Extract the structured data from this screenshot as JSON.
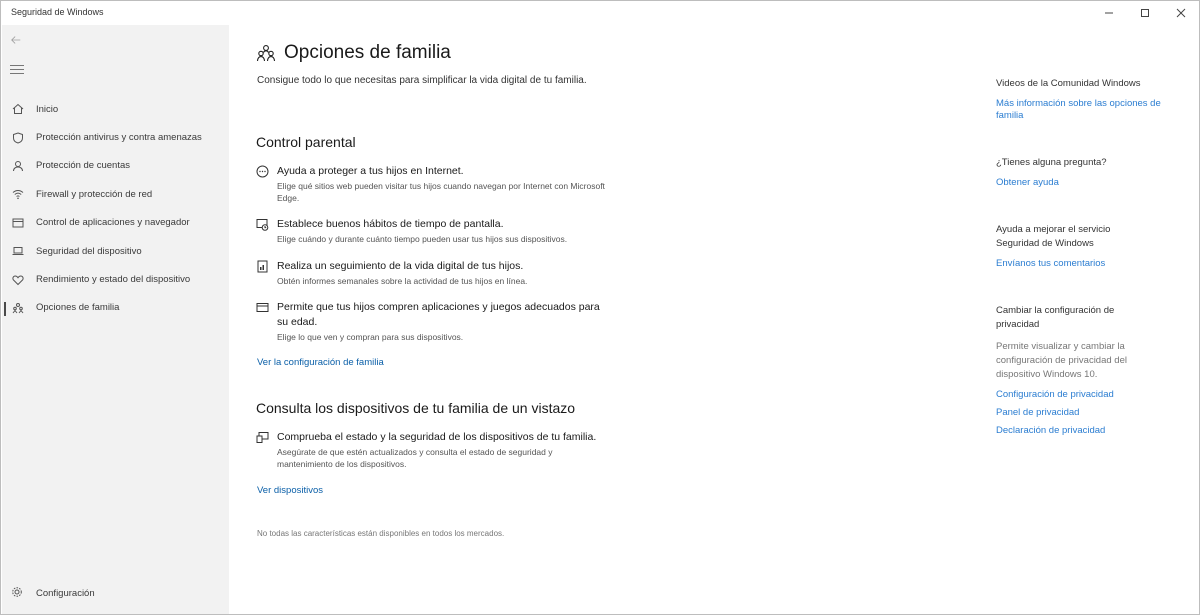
{
  "window": {
    "title": "Seguridad de Windows",
    "controls": {
      "minimize_icon": "minimize-icon",
      "maximize_icon": "maximize-icon",
      "close_icon": "close-icon"
    }
  },
  "sidebar": {
    "items": [
      {
        "label": "Inicio",
        "icon": "home-icon"
      },
      {
        "label": "Protección antivirus y contra amenazas",
        "icon": "shield-icon"
      },
      {
        "label": "Protección de cuentas",
        "icon": "person-icon"
      },
      {
        "label": "Firewall y protección de red",
        "icon": "wifi-icon"
      },
      {
        "label": "Control de aplicaciones y navegador",
        "icon": "app-browser-icon"
      },
      {
        "label": "Seguridad del dispositivo",
        "icon": "laptop-icon"
      },
      {
        "label": "Rendimiento y estado del dispositivo",
        "icon": "heart-icon"
      },
      {
        "label": "Opciones de familia",
        "icon": "family-icon",
        "active": true
      }
    ],
    "settings_label": "Configuración"
  },
  "main": {
    "title": "Opciones de familia",
    "description": "Consigue todo lo que necesitas para simplificar la vida digital de tu familia.",
    "parental": {
      "heading": "Control parental",
      "features": [
        {
          "title": "Ayuda a proteger a tus hijos en Internet.",
          "desc": "Elige qué sitios web pueden visitar tus hijos cuando navegan por Internet con Microsoft Edge.",
          "icon": "globe-icon"
        },
        {
          "title": "Establece buenos hábitos de tiempo de pantalla.",
          "desc": "Elige cuándo y durante cuánto tiempo pueden usar tus hijos sus dispositivos.",
          "icon": "screen-time-icon"
        },
        {
          "title": "Realiza un seguimiento de la vida digital de tus hijos.",
          "desc": "Obtén informes semanales sobre la actividad de tus hijos en línea.",
          "icon": "report-icon"
        },
        {
          "title": "Permite que tus hijos compren aplicaciones y juegos adecuados para su edad.",
          "desc": "Elige lo que ven y compran para sus dispositivos.",
          "icon": "card-icon"
        }
      ],
      "link": "Ver la configuración de familia"
    },
    "devices": {
      "heading": "Consulta los dispositivos de tu familia de un vistazo",
      "feature": {
        "title": "Comprueba el estado y la seguridad de los dispositivos de tu familia.",
        "desc": "Asegúrate de que estén actualizados y consulta el estado de seguridad y mantenimiento de los dispositivos.",
        "icon": "devices-icon"
      },
      "link": "Ver dispositivos"
    },
    "footnote": "No todas las características están disponibles en todos los mercados."
  },
  "aside": {
    "community": {
      "heading": "Videos de la Comunidad Windows",
      "link": "Más información sobre las opciones de familia"
    },
    "question": {
      "heading": "¿Tienes alguna pregunta?",
      "link": "Obtener ayuda"
    },
    "improve": {
      "heading": "Ayuda a mejorar el servicio Seguridad de Windows",
      "link": "Envíanos tus comentarios"
    },
    "privacy": {
      "heading": "Cambiar la configuración de privacidad",
      "text": "Permite visualizar y cambiar la configuración de privacidad del dispositivo Windows 10.",
      "links": [
        "Configuración de privacidad",
        "Panel de privacidad",
        "Declaración de privacidad"
      ]
    }
  }
}
